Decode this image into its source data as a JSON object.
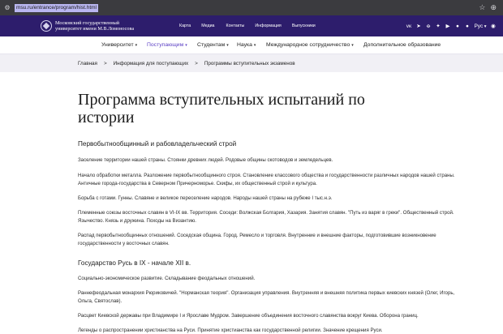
{
  "browser": {
    "url": "msu.ru/entrance/program/hist.html",
    "icons": [
      "page-info-icon",
      "bookmark-star-icon",
      "extensions-icon"
    ]
  },
  "header": {
    "logo_line1": "Московский государственный",
    "logo_line2": "университет имени М.В.Ломоносова",
    "nav": [
      "Карта",
      "Медиа",
      "Контакты",
      "Информация",
      "Выпускники"
    ],
    "icons": [
      "vk-icon",
      "telegram-icon",
      "ok-icon",
      "dzen-icon",
      "rutube-icon",
      "messenger-icon",
      "accessibility-icon",
      "eye-icon"
    ],
    "lang": "Рус"
  },
  "mainnav": {
    "items": [
      {
        "label": "Университет",
        "chev": "▾"
      },
      {
        "label": "Поступающим",
        "chev": "▾"
      },
      {
        "label": "Студентам",
        "chev": "▾"
      },
      {
        "label": "Наука",
        "chev": "▾"
      },
      {
        "label": "Международное сотрудничество",
        "chev": "▾"
      },
      {
        "label": "Дополнительное образование"
      }
    ],
    "accent": "#5b3fc4"
  },
  "breadcrumb": {
    "items": [
      "Главная",
      "Информация для поступающих",
      "Программы вступительных экзаменов"
    ],
    "sep": ">"
  },
  "page": {
    "title": "Программа вступительных испытаний по истории",
    "section1": "Первобытнообщинный и рабовладельческий строй",
    "paras1": [
      "Заселение территории нашей страны. Стоянки древних людей. Родовые общины скотоводов и земледельцев.",
      "Начало обработки металла. Разложение первобытнообщинного строя. Становление классового общества и государственности различных народов нашей страны. Античные города-государства в Северном Причерноморье. Скифы, их общественный строй и культура.",
      "Борьба с готами. Гунны. Славяне и великое переселение народов. Народы нашей страны на рубеже I тыс.н.э.",
      "Племенные союзы восточных славян в VI-IX вв. Территория. Соседи: Волжская Болгария, Хазария. Занятия славян. \"Путь из варяг в греки\". Общественный строй. Язычество. Князь и дружина. Походы на Византию.",
      "Распад первобытнообщинных отношений. Соседская община. Город. Ремесло и торговля. Внутренние и внешние факторы, подготовившие возникновение государственности у восточных славян."
    ],
    "section2": "Государство Русь в IX - начале XII в.",
    "paras2": [
      "Социально-экономическое развитие. Складывание феодальных отношений.",
      "Раннефеодальная монархия Рюриковичей. \"Норманская теория\". Организация управления. Внутренняя и внешняя политика первых киевских князей (Олег, Игорь, Ольга, Святослав).",
      "Расцвет Киевской державы при Владимире I и Ярославе Мудром. Завершение объединения восточного славянства вокруг Киева. Оборона границ.",
      "Легенды о распространении христианства на Руси. Принятие христианства как государственной религии. Значение крещения Руси."
    ]
  },
  "colors": {
    "header_bg": "#2d1d6c",
    "crumbs_bg": "#f1f0f5"
  }
}
